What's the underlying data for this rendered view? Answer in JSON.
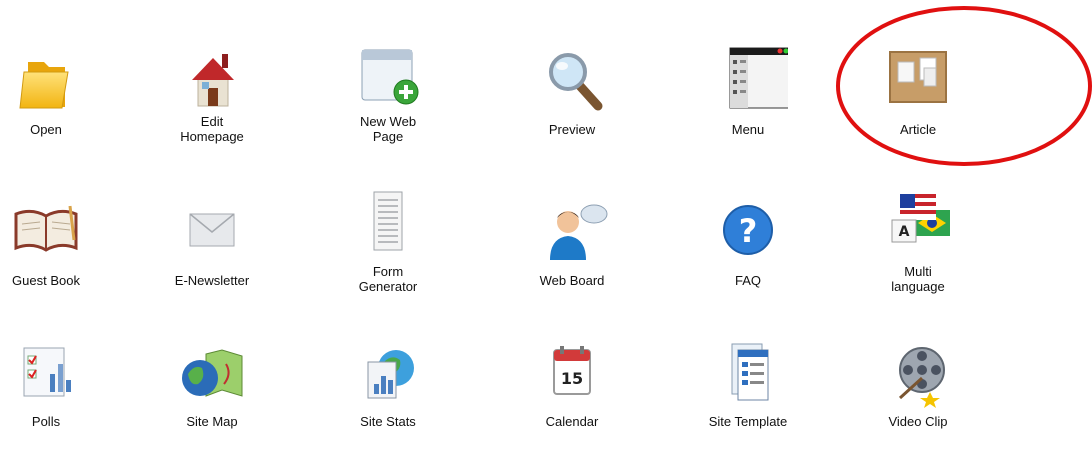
{
  "items": [
    {
      "label": "Open",
      "icon": "folder-icon"
    },
    {
      "label": "Edit\nHomepage",
      "icon": "house-icon"
    },
    {
      "label": "New Web\nPage",
      "icon": "new-page-icon"
    },
    {
      "label": "Preview",
      "icon": "magnifier-icon"
    },
    {
      "label": "Menu",
      "icon": "menu-window-icon"
    },
    {
      "label": "Article",
      "icon": "corkboard-icon"
    },
    {
      "label": "Guest Book",
      "icon": "book-icon"
    },
    {
      "label": "E-Newsletter",
      "icon": "envelope-icon"
    },
    {
      "label": "Form\nGenerator",
      "icon": "form-document-icon"
    },
    {
      "label": "Web Board",
      "icon": "user-speech-icon"
    },
    {
      "label": "FAQ",
      "icon": "question-icon"
    },
    {
      "label": "Multi\nlanguage",
      "icon": "flags-icon"
    },
    {
      "label": "Polls",
      "icon": "poll-chart-icon"
    },
    {
      "label": "Site Map",
      "icon": "globe-map-icon"
    },
    {
      "label": "Site Stats",
      "icon": "stats-globe-icon"
    },
    {
      "label": "Calendar",
      "icon": "calendar-icon"
    },
    {
      "label": "Site Template",
      "icon": "template-icon"
    },
    {
      "label": "Video Clip",
      "icon": "film-reel-icon"
    }
  ],
  "calendar_day": "15",
  "highlight_color": "#e01010"
}
